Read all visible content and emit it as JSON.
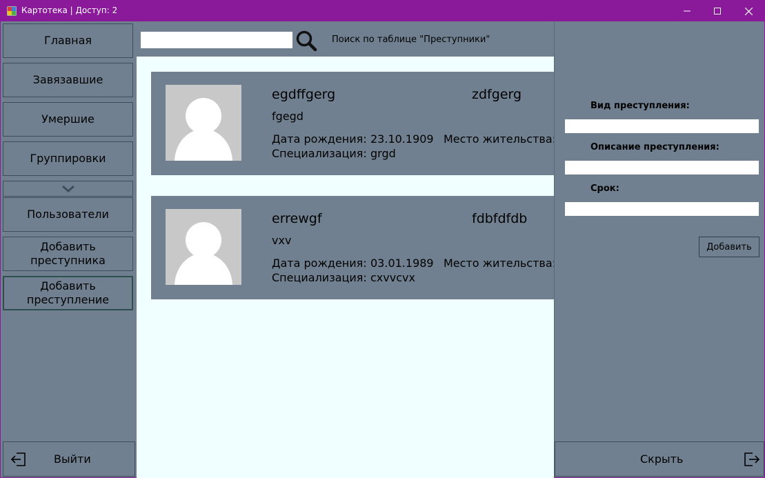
{
  "window": {
    "title": "Картотека | Доступ: 2",
    "accent_color": "#8b1a9b",
    "icons": [
      "app-icon",
      "minimize-icon",
      "maximize-icon",
      "close-icon"
    ]
  },
  "sidebar": {
    "items": [
      {
        "label": "Главная"
      },
      {
        "label": "Завязавшие"
      },
      {
        "label": "Умершие"
      },
      {
        "label": "Группировки"
      },
      {
        "label": "Пользователи"
      },
      {
        "label": "Добавить преступника"
      },
      {
        "label": "Добавить преступление",
        "selected": true
      }
    ],
    "collapse_icon": "chevron-down-icon",
    "logout_label": "Выйти",
    "logout_icon": "logout-icon"
  },
  "search": {
    "value": "",
    "hint": "Поиск по таблице \"Преступники\"",
    "icon": "search-icon"
  },
  "cards": [
    {
      "name": "egdffgerg",
      "surname": "zdfgerg",
      "nickname": "fgegd",
      "birth_label": "Дата рождения:",
      "birth_date": "23.10.1909",
      "residence_label": "Место жительства:",
      "spec_label": "Специализация:",
      "specialization": "grgd"
    },
    {
      "name": "errewgf",
      "surname": "fdbfdfdb",
      "nickname": "vxv",
      "birth_label": "Дата рождения:",
      "birth_date": "03.01.1989",
      "residence_label": "Место жительства:",
      "spec_label": "Специализация:",
      "specialization": "cxvvcvx"
    }
  ],
  "form": {
    "crime_type_label": "Вид преступления:",
    "crime_type_value": "",
    "description_label": "Описание преступления:",
    "description_value": "",
    "term_label": "Срок:",
    "term_value": "",
    "add_label": "Добавить"
  },
  "hide": {
    "label": "Скрыть",
    "icon": "exit-icon"
  },
  "colors": {
    "panel": "#708090",
    "content_bg": "#f0ffff",
    "avatar_bg": "#c8c8c8"
  }
}
